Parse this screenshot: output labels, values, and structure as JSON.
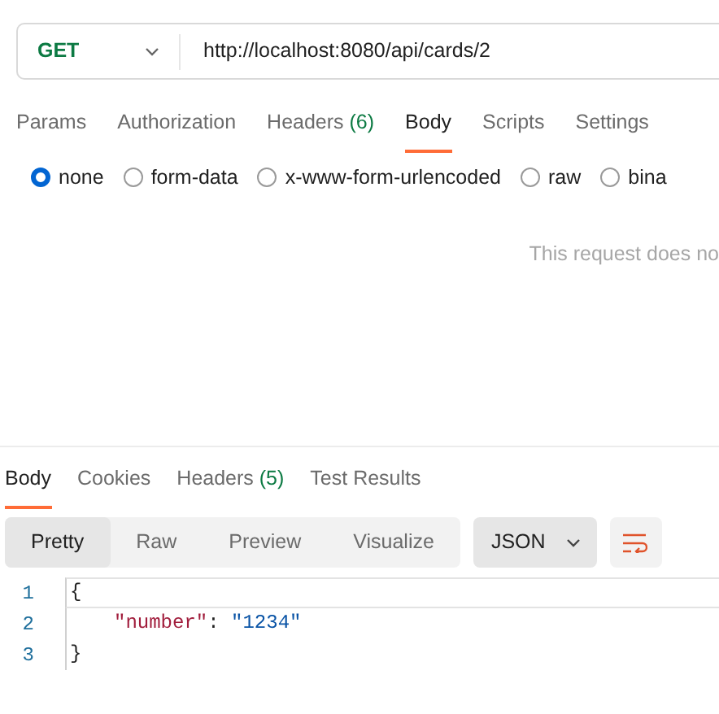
{
  "request": {
    "method": "GET",
    "url": "http://localhost:8080/api/cards/2"
  },
  "request_tabs": [
    {
      "label": "Params",
      "selected": false
    },
    {
      "label": "Authorization",
      "selected": false
    },
    {
      "label": "Headers",
      "count": "(6)",
      "selected": false
    },
    {
      "label": "Body",
      "selected": true
    },
    {
      "label": "Scripts",
      "selected": false
    },
    {
      "label": "Settings",
      "selected": false
    }
  ],
  "body_types": [
    {
      "label": "none",
      "selected": true
    },
    {
      "label": "form-data",
      "selected": false
    },
    {
      "label": "x-www-form-urlencoded",
      "selected": false
    },
    {
      "label": "raw",
      "selected": false
    },
    {
      "label": "bina",
      "selected": false
    }
  ],
  "body_message": "This request does no",
  "response_tabs": [
    {
      "label": "Body",
      "selected": true
    },
    {
      "label": "Cookies",
      "selected": false
    },
    {
      "label": "Headers",
      "count": "(5)",
      "selected": false
    },
    {
      "label": "Test Results",
      "selected": false
    }
  ],
  "view_modes": [
    {
      "label": "Pretty",
      "selected": true
    },
    {
      "label": "Raw",
      "selected": false
    },
    {
      "label": "Preview",
      "selected": false
    },
    {
      "label": "Visualize",
      "selected": false
    }
  ],
  "format": "JSON",
  "code_lines": [
    {
      "number": "1",
      "selected": true,
      "tokens": [
        {
          "kind": "punct",
          "text": "{"
        }
      ]
    },
    {
      "number": "2",
      "selected": false,
      "tokens": [
        {
          "kind": "key",
          "text": "\"number\""
        },
        {
          "kind": "punct",
          "text": ": "
        },
        {
          "kind": "string",
          "text": "\"1234\""
        }
      ]
    },
    {
      "number": "3",
      "selected": false,
      "tokens": [
        {
          "kind": "punct",
          "text": "}"
        }
      ]
    }
  ]
}
